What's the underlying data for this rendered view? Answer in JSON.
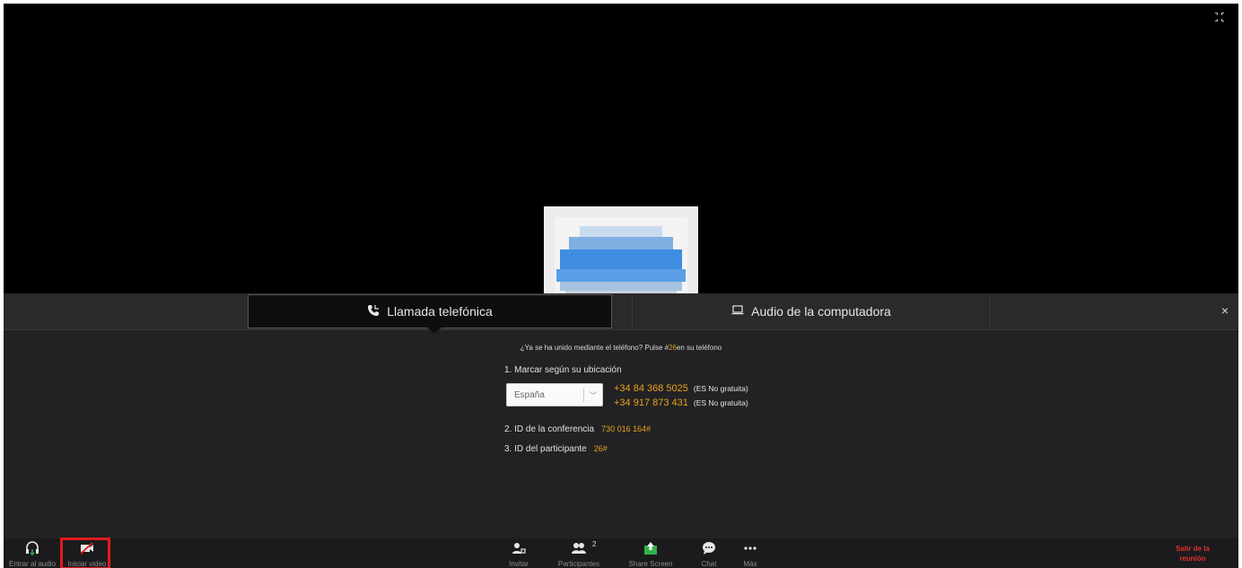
{
  "header": {
    "fullscreen_icon": "fullscreen-exit-icon"
  },
  "audio_dialog": {
    "tabs": [
      {
        "label": "Llamada telefónica",
        "icon": "phone-icon",
        "selected": true
      },
      {
        "label": "Audio de la computadora",
        "icon": "laptop-icon",
        "selected": false
      }
    ],
    "close_label": "×",
    "joined_note_prefix": "¿Ya se ha unido mediante el teléfono? Pulse #",
    "joined_note_code": "26",
    "joined_note_suffix": "en su teléfono",
    "step1_title": "1. Marcar según su ubicación",
    "country_value": "España",
    "chevron": "﹀",
    "phone_numbers": [
      {
        "number": "+34 84 368 5025",
        "tag": "(ES No gratuita)"
      },
      {
        "number": "+34 917 873 431",
        "tag": "(ES No gratuita)"
      }
    ],
    "step2_title": "2. ID de la conferencia",
    "conference_id": "730 016 164#",
    "step3_title": "3. ID del participante",
    "participant_id": "26#"
  },
  "toolbar": {
    "faint_text": "...",
    "audio_label": "Entrar al audio",
    "video_label": "Iniciar video",
    "invite_label": "Invitar",
    "participants_label": "Participantes",
    "participants_count": "2",
    "share_label": "Share Screen",
    "chat_label": "Chat",
    "more_label": "Más",
    "leave_label_line1": "Salir de la",
    "leave_label_line2": "reunión"
  },
  "colors": {
    "accent": "#e8a21c",
    "leave": "#e0322d",
    "share_green": "#2fb24a",
    "highlight": "#e01b1b"
  }
}
